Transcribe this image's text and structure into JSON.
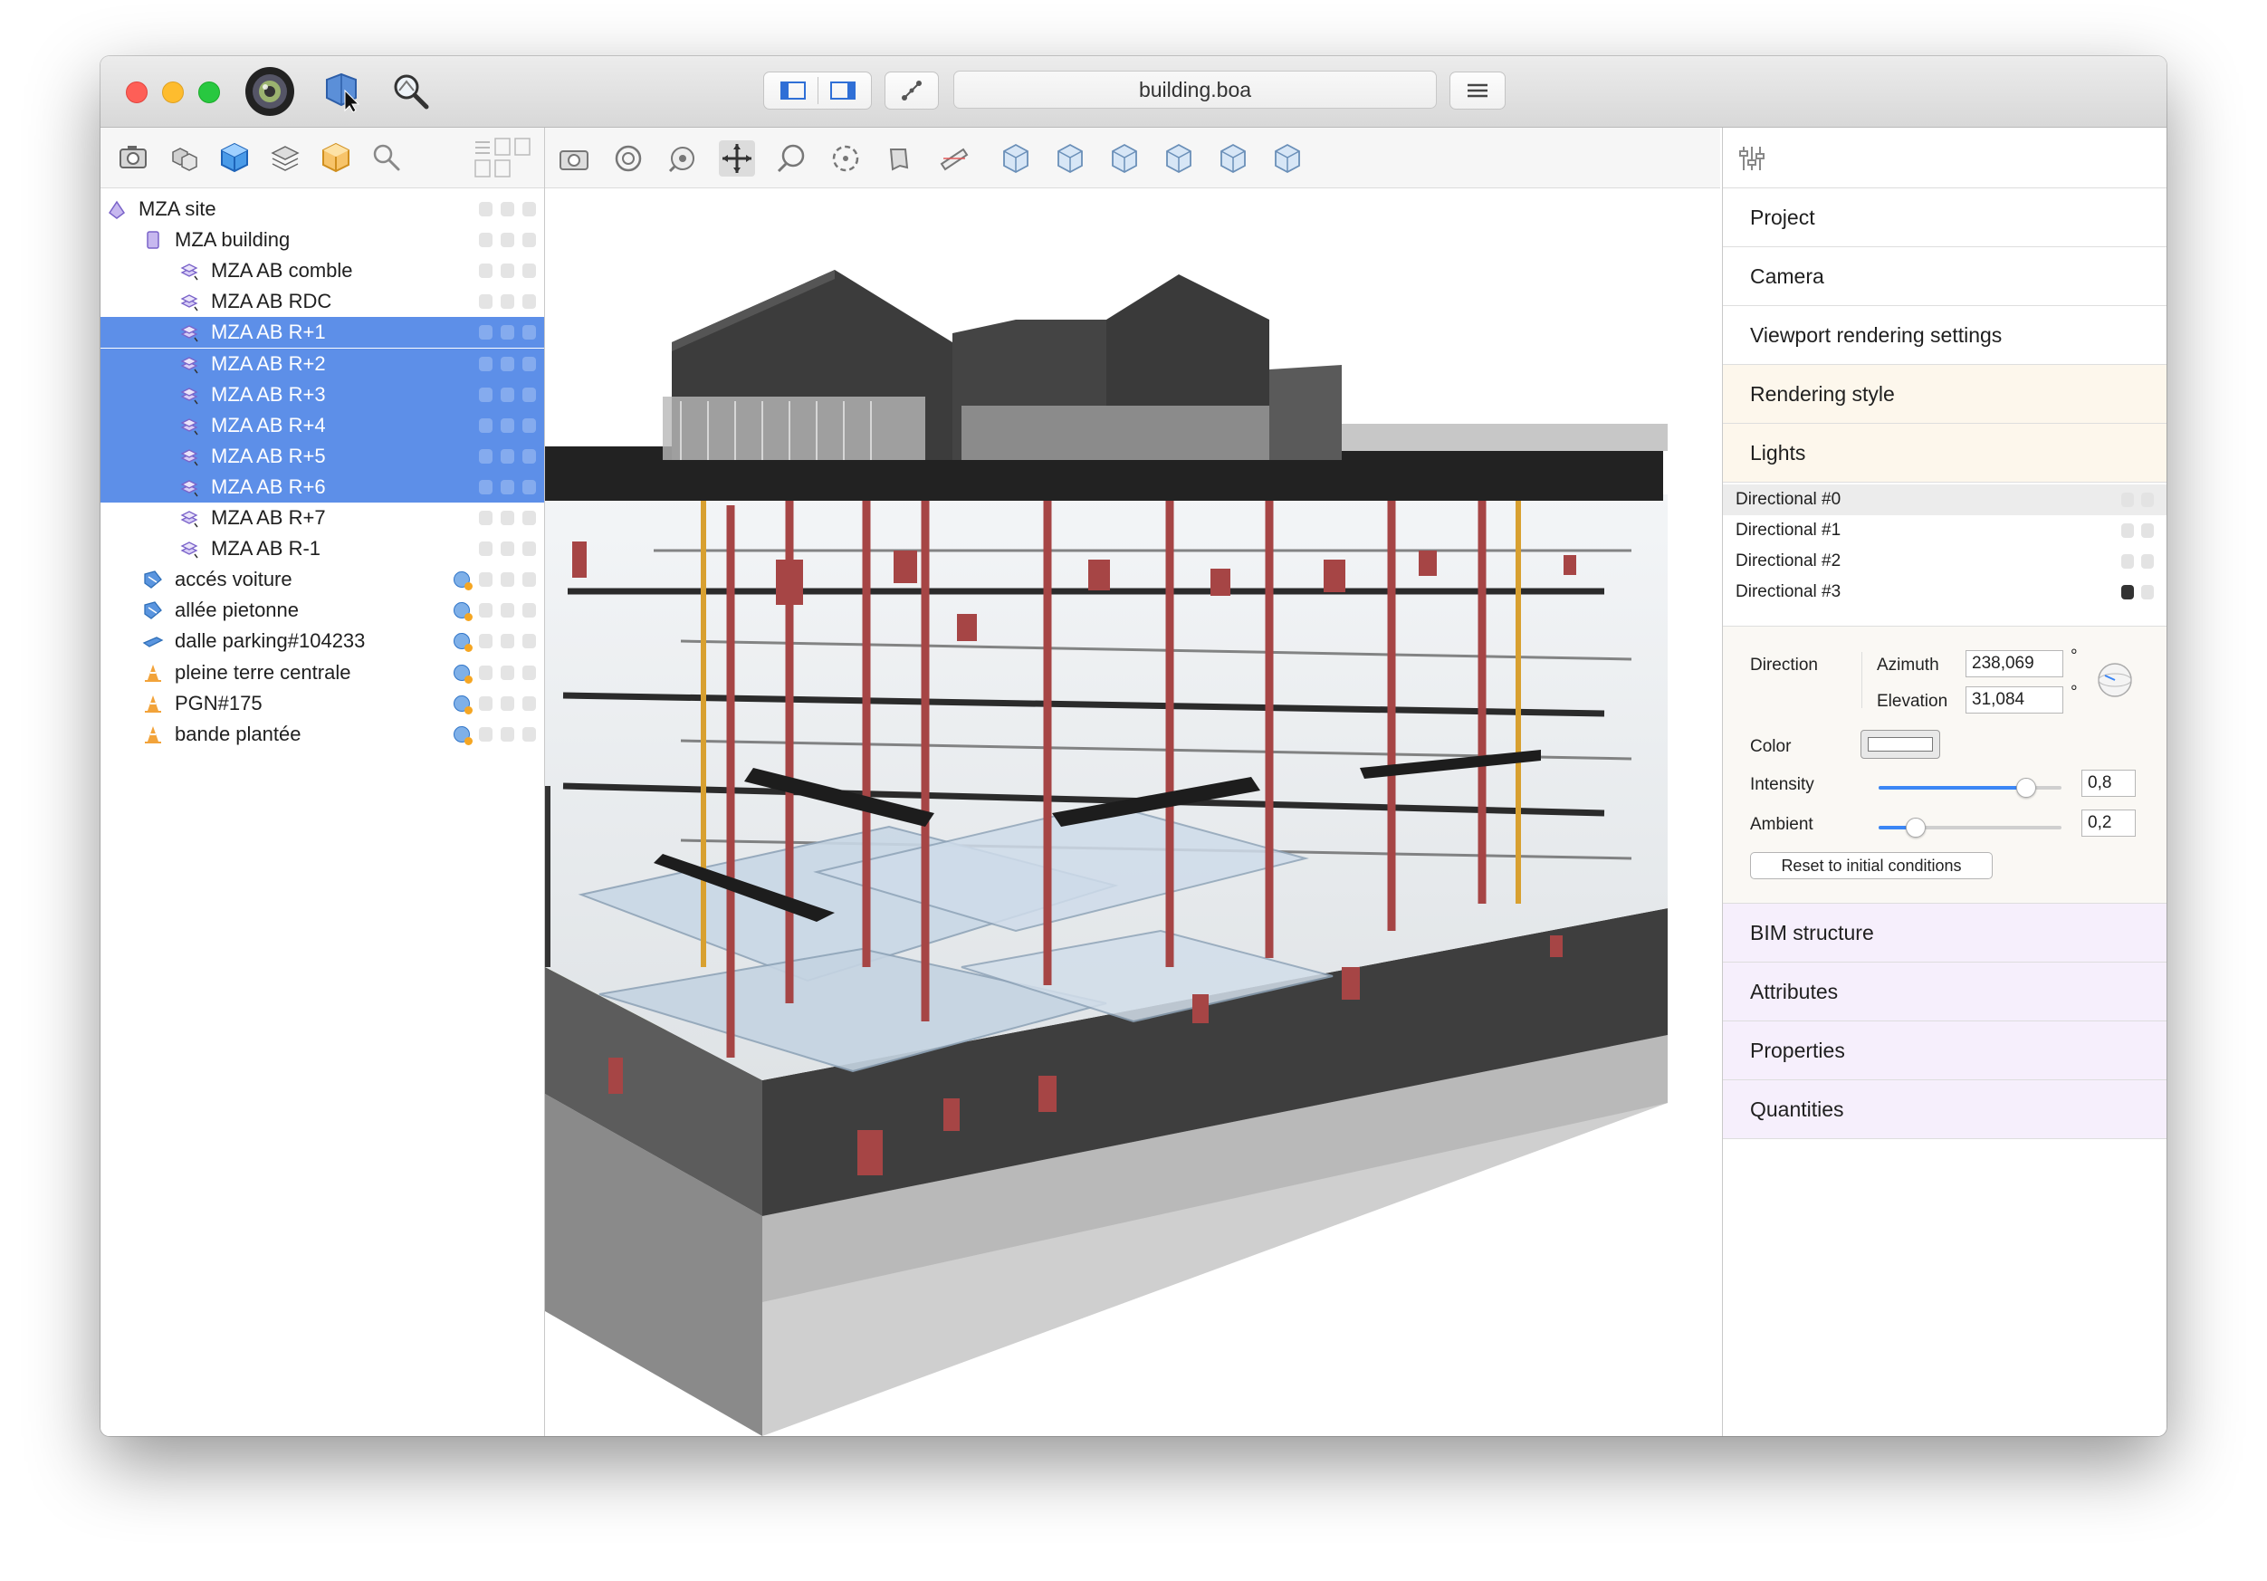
{
  "window": {
    "document_title": "building.boa"
  },
  "titlebar_icons": [
    "camera-lens-icon",
    "select-cursor-icon",
    "zoom-search-icon"
  ],
  "left_toolbar_icons": [
    "snapshot-icon",
    "objects-icon",
    "model-cube-icon",
    "layers-icon",
    "materials-icon",
    "search-icon",
    "list-view-icon"
  ],
  "tree": [
    {
      "label": "MZA site",
      "icon": "site-icon",
      "level": 0,
      "selected": false,
      "georef": false
    },
    {
      "label": "MZA building",
      "icon": "building-icon",
      "level": 1,
      "selected": false,
      "georef": false
    },
    {
      "label": "MZA AB comble",
      "icon": "storey-icon",
      "level": 2,
      "selected": false,
      "georef": false
    },
    {
      "label": "MZA AB RDC",
      "icon": "storey-icon",
      "level": 2,
      "selected": false,
      "georef": false
    },
    {
      "label": "MZA AB R+1",
      "icon": "storey-icon",
      "level": 2,
      "selected": true,
      "georef": false
    },
    {
      "label": "MZA AB R+2",
      "icon": "storey-icon",
      "level": 2,
      "selected": true,
      "georef": false
    },
    {
      "label": "MZA AB R+3",
      "icon": "storey-icon",
      "level": 2,
      "selected": true,
      "georef": false
    },
    {
      "label": "MZA AB R+4",
      "icon": "storey-icon",
      "level": 2,
      "selected": true,
      "georef": false
    },
    {
      "label": "MZA AB R+5",
      "icon": "storey-icon",
      "level": 2,
      "selected": true,
      "georef": false
    },
    {
      "label": "MZA AB R+6",
      "icon": "storey-icon",
      "level": 2,
      "selected": true,
      "georef": false
    },
    {
      "label": "MZA AB R+7",
      "icon": "storey-icon",
      "level": 2,
      "selected": false,
      "georef": false
    },
    {
      "label": "MZA AB R-1",
      "icon": "storey-icon",
      "level": 2,
      "selected": false,
      "georef": false
    },
    {
      "label": "accés voiture",
      "icon": "road-icon",
      "level": 1,
      "selected": false,
      "georef": true
    },
    {
      "label": "allée pietonne",
      "icon": "road-icon",
      "level": 1,
      "selected": false,
      "georef": true
    },
    {
      "label": "dalle parking#104233",
      "icon": "slab-icon",
      "level": 1,
      "selected": false,
      "georef": true
    },
    {
      "label": "pleine terre centrale",
      "icon": "terrain-cone-icon",
      "level": 1,
      "selected": false,
      "georef": true
    },
    {
      "label": "PGN#175",
      "icon": "terrain-cone-icon",
      "level": 1,
      "selected": false,
      "georef": true
    },
    {
      "label": "bande plantée",
      "icon": "terrain-cone-icon",
      "level": 1,
      "selected": false,
      "georef": true
    }
  ],
  "viewport_toolbar_icons": [
    "camera-icon",
    "orbit-target-icon",
    "look-around-icon",
    "pan-cross-icon",
    "zoom-lasso-icon",
    "rotate-circle-icon",
    "walk-icon",
    "section-plane-icon",
    "view-iso-1-icon",
    "view-iso-2-icon",
    "view-iso-3-icon",
    "view-iso-4-icon",
    "view-iso-5-icon",
    "view-iso-6-icon"
  ],
  "inspector": {
    "settings_icon": "sliders-icon",
    "sections_top": [
      {
        "label": "Project",
        "tone": "plain"
      },
      {
        "label": "Camera",
        "tone": "plain"
      },
      {
        "label": "Viewport rendering settings",
        "tone": "plain"
      },
      {
        "label": "Rendering style",
        "tone": "warm"
      },
      {
        "label": "Lights",
        "tone": "warm"
      }
    ],
    "lights": [
      {
        "label": "Directional #0",
        "highlighted": true,
        "locked": false
      },
      {
        "label": "Directional #1",
        "highlighted": false,
        "locked": false
      },
      {
        "label": "Directional #2",
        "highlighted": false,
        "locked": false
      },
      {
        "label": "Directional #3",
        "highlighted": false,
        "locked": true
      }
    ],
    "light_props": {
      "direction_label": "Direction",
      "azimuth_label": "Azimuth",
      "azimuth_value": "238,069",
      "elevation_label": "Elevation",
      "elevation_value": "31,084",
      "degree_symbol": "°",
      "color_label": "Color",
      "intensity_label": "Intensity",
      "intensity_value": "0,8",
      "intensity_fraction": 0.8,
      "ambient_label": "Ambient",
      "ambient_value": "0,2",
      "ambient_fraction": 0.2,
      "reset_label": "Reset to initial conditions"
    },
    "sections_bottom": [
      {
        "label": "BIM structure",
        "tone": "purple"
      },
      {
        "label": "Attributes",
        "tone": "purple"
      },
      {
        "label": "Properties",
        "tone": "purple"
      },
      {
        "label": "Quantities",
        "tone": "purple"
      }
    ]
  },
  "colors": {
    "selection": "#5d8fe8",
    "accent": "#3b86f5",
    "pipe": "#a64545"
  }
}
